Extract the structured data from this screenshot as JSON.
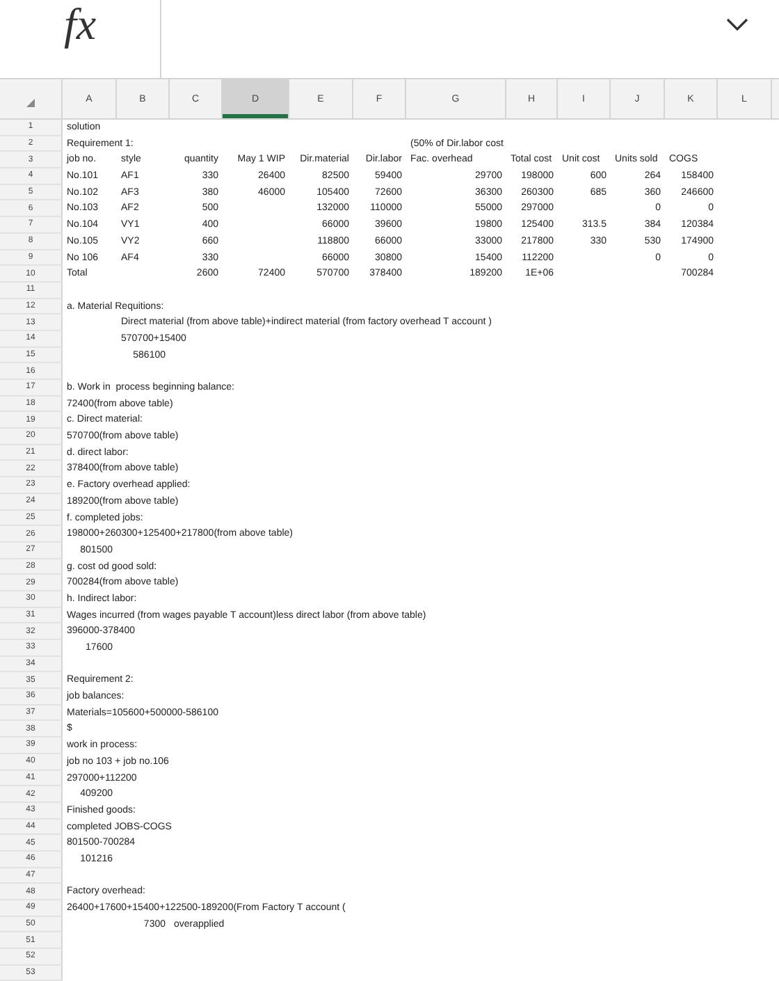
{
  "formula_bar": {
    "label": "fx"
  },
  "columns": [
    {
      "label": "A",
      "selected": false
    },
    {
      "label": "B",
      "selected": false
    },
    {
      "label": "C",
      "selected": false
    },
    {
      "label": "D",
      "selected": true
    },
    {
      "label": "E",
      "selected": false
    },
    {
      "label": "F",
      "selected": false
    },
    {
      "label": "G",
      "selected": false
    },
    {
      "label": "H",
      "selected": false
    },
    {
      "label": "I",
      "selected": false
    },
    {
      "label": "J",
      "selected": false
    },
    {
      "label": "K",
      "selected": false
    },
    {
      "label": "L",
      "selected": false
    }
  ],
  "rows": [
    {
      "number": "1",
      "A": {
        "text": "solution",
        "kind": "label"
      }
    },
    {
      "number": "2",
      "A": {
        "text": "Requirement 1:",
        "kind": "label"
      },
      "G": {
        "text": "(50% of Dir.labor cost",
        "kind": "label"
      }
    },
    {
      "number": "3",
      "A": {
        "text": "job no.",
        "kind": "label"
      },
      "B": {
        "text": "style",
        "kind": "label"
      },
      "C": {
        "text": "quantity",
        "kind": "number"
      },
      "D": {
        "text": "May 1 WIP",
        "kind": "number"
      },
      "E": {
        "text": "Dir.material",
        "kind": "number"
      },
      "F": {
        "text": "Dir.labor",
        "kind": "number"
      },
      "G": {
        "text": "Fac. overhead",
        "kind": "label"
      },
      "H": {
        "text": "Total cost",
        "kind": "label"
      },
      "I": {
        "text": "Unit cost",
        "kind": "label"
      },
      "J": {
        "text": "Units sold",
        "kind": "label"
      },
      "K": {
        "text": "COGS",
        "kind": "label"
      }
    },
    {
      "number": "4",
      "A": {
        "text": "No.101",
        "kind": "label"
      },
      "B": {
        "text": "AF1",
        "kind": "label"
      },
      "C": {
        "text": "330",
        "kind": "number"
      },
      "D": {
        "text": "26400",
        "kind": "number"
      },
      "E": {
        "text": "82500",
        "kind": "number"
      },
      "F": {
        "text": "59400",
        "kind": "number"
      },
      "G": {
        "text": "29700",
        "kind": "number"
      },
      "H": {
        "text": "198000",
        "kind": "number"
      },
      "I": {
        "text": "600",
        "kind": "number"
      },
      "J": {
        "text": "264",
        "kind": "number"
      },
      "K": {
        "text": "158400",
        "kind": "number"
      }
    },
    {
      "number": "5",
      "A": {
        "text": "No.102",
        "kind": "label"
      },
      "B": {
        "text": "AF3",
        "kind": "label"
      },
      "C": {
        "text": "380",
        "kind": "number"
      },
      "D": {
        "text": "46000",
        "kind": "number"
      },
      "E": {
        "text": "105400",
        "kind": "number"
      },
      "F": {
        "text": "72600",
        "kind": "number"
      },
      "G": {
        "text": "36300",
        "kind": "number"
      },
      "H": {
        "text": "260300",
        "kind": "number"
      },
      "I": {
        "text": "685",
        "kind": "number"
      },
      "J": {
        "text": "360",
        "kind": "number"
      },
      "K": {
        "text": "246600",
        "kind": "number"
      }
    },
    {
      "number": "6",
      "A": {
        "text": "No.103",
        "kind": "label"
      },
      "B": {
        "text": "AF2",
        "kind": "label"
      },
      "C": {
        "text": "500",
        "kind": "number"
      },
      "E": {
        "text": "132000",
        "kind": "number"
      },
      "F": {
        "text": "110000",
        "kind": "number"
      },
      "G": {
        "text": "55000",
        "kind": "number"
      },
      "H": {
        "text": "297000",
        "kind": "number"
      },
      "J": {
        "text": "0",
        "kind": "number"
      },
      "K": {
        "text": "0",
        "kind": "number"
      }
    },
    {
      "number": "7",
      "A": {
        "text": "No.104",
        "kind": "label"
      },
      "B": {
        "text": "VY1",
        "kind": "label"
      },
      "C": {
        "text": "400",
        "kind": "number"
      },
      "E": {
        "text": "66000",
        "kind": "number"
      },
      "F": {
        "text": "39600",
        "kind": "number"
      },
      "G": {
        "text": "19800",
        "kind": "number"
      },
      "H": {
        "text": "125400",
        "kind": "number"
      },
      "I": {
        "text": "313.5",
        "kind": "number"
      },
      "J": {
        "text": "384",
        "kind": "number"
      },
      "K": {
        "text": "120384",
        "kind": "number"
      }
    },
    {
      "number": "8",
      "A": {
        "text": "No.105",
        "kind": "label"
      },
      "B": {
        "text": "VY2",
        "kind": "label"
      },
      "C": {
        "text": "660",
        "kind": "number"
      },
      "E": {
        "text": "118800",
        "kind": "number"
      },
      "F": {
        "text": "66000",
        "kind": "number"
      },
      "G": {
        "text": "33000",
        "kind": "number"
      },
      "H": {
        "text": "217800",
        "kind": "number"
      },
      "I": {
        "text": "330",
        "kind": "number"
      },
      "J": {
        "text": "530",
        "kind": "number"
      },
      "K": {
        "text": "174900",
        "kind": "number"
      }
    },
    {
      "number": "9",
      "A": {
        "text": "No 106",
        "kind": "label"
      },
      "B": {
        "text": "AF4",
        "kind": "label"
      },
      "C": {
        "text": "330",
        "kind": "number"
      },
      "E": {
        "text": "66000",
        "kind": "number"
      },
      "F": {
        "text": "30800",
        "kind": "number"
      },
      "G": {
        "text": "15400",
        "kind": "number"
      },
      "H": {
        "text": "112200",
        "kind": "number"
      },
      "J": {
        "text": "0",
        "kind": "number"
      },
      "K": {
        "text": "0",
        "kind": "number"
      }
    },
    {
      "number": "10",
      "A": {
        "text": "Total",
        "kind": "label"
      },
      "C": {
        "text": "2600",
        "kind": "number"
      },
      "D": {
        "text": "72400",
        "kind": "number"
      },
      "E": {
        "text": "570700",
        "kind": "number"
      },
      "F": {
        "text": "378400",
        "kind": "number"
      },
      "G": {
        "text": "189200",
        "kind": "number"
      },
      "H": {
        "text": "1E+06",
        "kind": "number"
      },
      "K": {
        "text": "700284",
        "kind": "number"
      }
    },
    {
      "number": "11"
    },
    {
      "number": "12",
      "A": {
        "text": "a. Material Requitions:",
        "kind": "label"
      }
    },
    {
      "number": "13",
      "B": {
        "text": "Direct material (from above table)+indirect material (from factory overhead T account )",
        "kind": "label"
      }
    },
    {
      "number": "14",
      "B": {
        "text": "570700+15400",
        "kind": "label"
      }
    },
    {
      "number": "15",
      "B": {
        "text": "586100",
        "kind": "number"
      }
    },
    {
      "number": "16"
    },
    {
      "number": "17",
      "A": {
        "text": "b. Work in  process beginning balance:",
        "kind": "label"
      }
    },
    {
      "number": "18",
      "A": {
        "text": "72400(from above table)",
        "kind": "label"
      }
    },
    {
      "number": "19",
      "A": {
        "text": "c. Direct material:",
        "kind": "label"
      }
    },
    {
      "number": "20",
      "A": {
        "text": "570700(from above table)",
        "kind": "label"
      }
    },
    {
      "number": "21",
      "A": {
        "text": "d. direct labor:",
        "kind": "label"
      }
    },
    {
      "number": "22",
      "A": {
        "text": "378400(from above table)",
        "kind": "label"
      }
    },
    {
      "number": "23",
      "A": {
        "text": "e. Factory overhead applied:",
        "kind": "label"
      }
    },
    {
      "number": "24",
      "A": {
        "text": "189200(from above table)",
        "kind": "label"
      }
    },
    {
      "number": "25",
      "A": {
        "text": "f. completed jobs:",
        "kind": "label"
      }
    },
    {
      "number": "26",
      "A": {
        "text": "198000+260300+125400+217800(from above table)",
        "kind": "label"
      }
    },
    {
      "number": "27",
      "A": {
        "text": "801500",
        "kind": "number"
      }
    },
    {
      "number": "28",
      "A": {
        "text": "g. cost od good sold:",
        "kind": "label"
      }
    },
    {
      "number": "29",
      "A": {
        "text": "700284(from above table)",
        "kind": "label"
      }
    },
    {
      "number": "30",
      "A": {
        "text": "h. Indirect labor:",
        "kind": "label"
      }
    },
    {
      "number": "31",
      "A": {
        "text": "Wages incurred (from wages payable T account)less direct labor (from above table)",
        "kind": "label"
      }
    },
    {
      "number": "32",
      "A": {
        "text": "396000-378400",
        "kind": "label"
      }
    },
    {
      "number": "33",
      "A": {
        "text": "17600",
        "kind": "number"
      }
    },
    {
      "number": "34"
    },
    {
      "number": "35",
      "A": {
        "text": "Requirement 2:",
        "kind": "label"
      }
    },
    {
      "number": "36",
      "A": {
        "text": "job balances:",
        "kind": "label"
      }
    },
    {
      "number": "37",
      "A": {
        "text": "Materials=105600+500000-586100",
        "kind": "label"
      }
    },
    {
      "number": "38",
      "A": {
        "text": "$",
        "kind": "label"
      }
    },
    {
      "number": "39",
      "A": {
        "text": "work in process:",
        "kind": "label"
      }
    },
    {
      "number": "40",
      "A": {
        "text": "job no 103 + job no.106",
        "kind": "label"
      }
    },
    {
      "number": "41",
      "A": {
        "text": "297000+112200",
        "kind": "label"
      }
    },
    {
      "number": "42",
      "A": {
        "text": "409200",
        "kind": "number"
      }
    },
    {
      "number": "43",
      "A": {
        "text": "Finished goods:",
        "kind": "label"
      }
    },
    {
      "number": "44",
      "A": {
        "text": "completed JOBS-COGS",
        "kind": "label"
      }
    },
    {
      "number": "45",
      "A": {
        "text": "801500-700284",
        "kind": "label"
      }
    },
    {
      "number": "46",
      "A": {
        "text": "101216",
        "kind": "number"
      }
    },
    {
      "number": "47"
    },
    {
      "number": "48",
      "A": {
        "text": "Factory overhead:",
        "kind": "label"
      }
    },
    {
      "number": "49",
      "A": {
        "text": "26400+17600+15400+122500-189200(From Factory T account (",
        "kind": "label"
      }
    },
    {
      "number": "50",
      "B": {
        "text": "7300",
        "kind": "number"
      },
      "C": {
        "text": "overapplied",
        "kind": "label"
      }
    },
    {
      "number": "51"
    },
    {
      "number": "52"
    },
    {
      "number": "53"
    }
  ]
}
